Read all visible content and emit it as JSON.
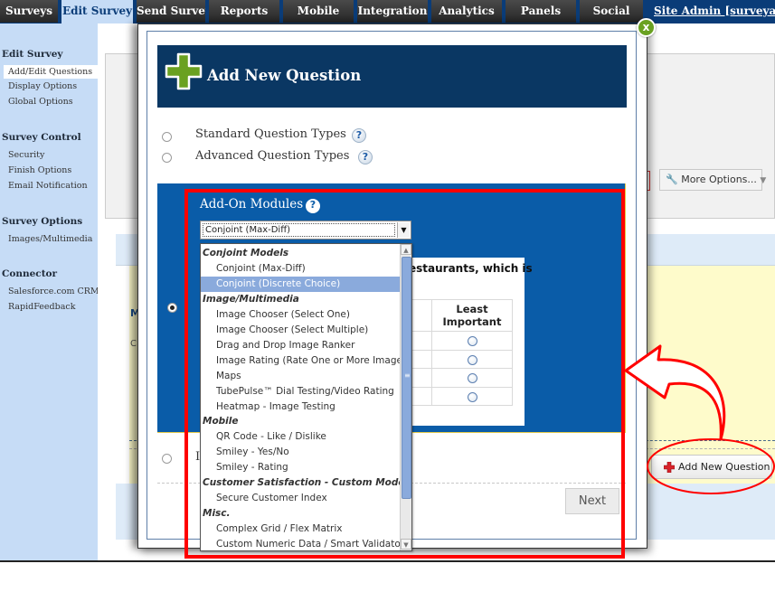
{
  "nav": {
    "tabs": [
      {
        "label": "Surveys",
        "active": false
      },
      {
        "label": "Edit Survey",
        "active": true
      },
      {
        "label": "Send Survey",
        "active": false
      },
      {
        "label": "Reports",
        "active": false
      },
      {
        "label": "Mobile",
        "active": false
      },
      {
        "label": "Integration",
        "active": false
      },
      {
        "label": "Analytics",
        "active": false
      },
      {
        "label": "Panels",
        "active": false
      },
      {
        "label": "Social",
        "active": false
      }
    ],
    "user_link": "Site Admin [surveyanaly"
  },
  "sidebar": {
    "sections": [
      {
        "title": "Edit Survey",
        "items": [
          "Add/Edit Questions",
          "Display Options",
          "Global Options"
        ]
      },
      {
        "title": "Survey Control",
        "items": [
          "Security",
          "Finish Options",
          "Email Notification"
        ]
      },
      {
        "title": "Survey Options",
        "items": [
          "Images/Multimedia"
        ]
      },
      {
        "title": "Connector",
        "items": [
          "Salesforce.com CRM",
          "RapidFeedback"
        ]
      }
    ],
    "active_item": "Add/Edit Questions"
  },
  "background": {
    "more_options_label": "More Options...",
    "add_new_question_label": "Add New Question",
    "partial_heading": "M",
    "partial_text": "C"
  },
  "modal": {
    "title": "Add New Question",
    "close_label": "x",
    "options": [
      {
        "label": "Standard Question Types",
        "checked": false
      },
      {
        "label": "Advanced Question Types",
        "checked": false
      },
      {
        "label": "Add-On Modules",
        "checked": true
      },
      {
        "label": "I",
        "checked": false
      }
    ],
    "help_glyph": "?",
    "addon_select": {
      "value": "Conjoint (Max-Diff)",
      "dropdown": [
        {
          "type": "group",
          "label": "Conjoint Models"
        },
        {
          "type": "option",
          "label": "Conjoint (Max-Diff)"
        },
        {
          "type": "option",
          "label": "Conjoint (Discrete Choice)",
          "selected": true
        },
        {
          "type": "group",
          "label": "Image/Multimedia"
        },
        {
          "type": "option",
          "label": "Image Chooser (Select One)"
        },
        {
          "type": "option",
          "label": "Image Chooser (Select Multiple)"
        },
        {
          "type": "option",
          "label": "Drag and Drop Image Ranker"
        },
        {
          "type": "option",
          "label": "Image Rating (Rate One or More Images)"
        },
        {
          "type": "option",
          "label": "Maps"
        },
        {
          "type": "option",
          "label": "TubePulse™ Dial Testing/Video Rating"
        },
        {
          "type": "option",
          "label": "Heatmap - Image Testing"
        },
        {
          "type": "group",
          "label": "Mobile"
        },
        {
          "type": "option",
          "label": "QR Code - Like / Dislike"
        },
        {
          "type": "option",
          "label": "Smiley - Yes/No"
        },
        {
          "type": "option",
          "label": "Smiley - Rating"
        },
        {
          "type": "group",
          "label": "Customer Satisfaction - Custom Models"
        },
        {
          "type": "option",
          "label": "Secure Customer Index"
        },
        {
          "type": "group",
          "label": "Misc."
        },
        {
          "type": "option",
          "label": "Complex Grid / Flex Matrix"
        },
        {
          "type": "option",
          "label": "Custom Numeric Data / Smart Validator"
        }
      ]
    },
    "preview": {
      "question_fragment": "estaurants, which is",
      "column_header_line1": "Least",
      "column_header_line2": "Important",
      "rows": 4
    },
    "next_label": "Next"
  },
  "colors": {
    "nav_bg": "#0a3c78",
    "modal_header": "#0a3763",
    "addon_panel": "#0a5ca8",
    "accent_green": "#6aa121",
    "annotation_red": "#ff0000",
    "dropdown_selected": "#8aaadc"
  }
}
